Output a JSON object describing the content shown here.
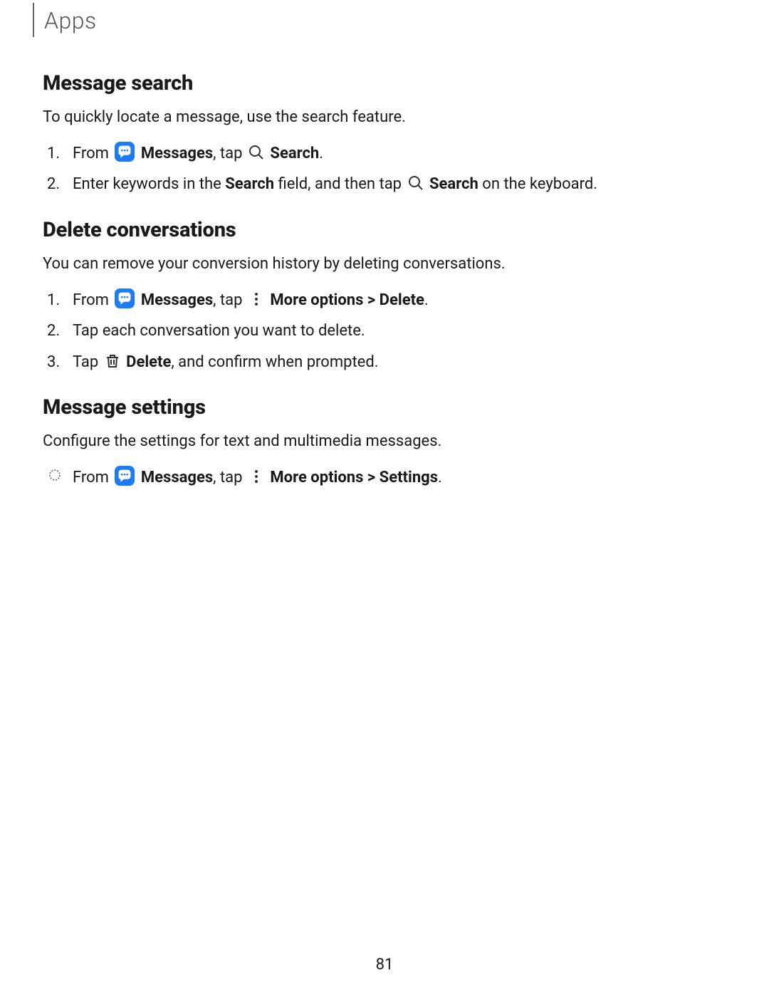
{
  "header": {
    "title": "Apps"
  },
  "pageNumber": "81",
  "sections": {
    "s1": {
      "heading": "Message search",
      "intro": "To quickly locate a message, use the search feature.",
      "step1": {
        "num": "1.",
        "t1": "From ",
        "t2": "Messages",
        "t3": ", tap ",
        "t4": "Search",
        "t5": "."
      },
      "step2": {
        "num": "2.",
        "t1": "Enter keywords in the ",
        "t2": "Search",
        "t3": " field, and then tap ",
        "t4": "Search",
        "t5": " on the keyboard."
      }
    },
    "s2": {
      "heading": "Delete conversations",
      "intro": "You can remove your conversion history by deleting conversations.",
      "step1": {
        "num": "1.",
        "t1": "From ",
        "t2": "Messages",
        "t3": ", tap ",
        "t4": "More options > Delete",
        "t5": "."
      },
      "step2": {
        "num": "2.",
        "t1": "Tap each conversation you want to delete."
      },
      "step3": {
        "num": "3.",
        "t1": "Tap ",
        "t2": "Delete",
        "t3": ", and confirm when prompted."
      }
    },
    "s3": {
      "heading": "Message settings",
      "intro": "Configure the settings for text and multimedia messages.",
      "step1": {
        "t1": "From ",
        "t2": "Messages",
        "t3": ", tap ",
        "t4": "More options > Settings",
        "t5": "."
      }
    }
  }
}
